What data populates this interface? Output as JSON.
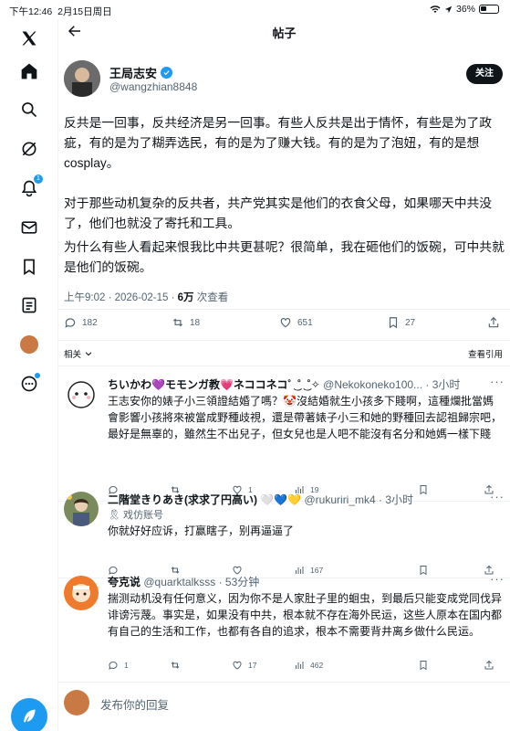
{
  "statusbar": {
    "time": "下午12:46",
    "date": "2月15日周日",
    "battery": "36%"
  },
  "topbar": {
    "title": "帖子"
  },
  "post": {
    "name": "王局志安",
    "handle": "@wangzhian8848",
    "follow_label": "关注",
    "paragraphs": [
      "反共是一回事，反共经济是另一回事。有些人反共是出于情怀，有些是为了政疵，有的是为了糊弄选民，有的是为了赚大钱。有的是为了泡妞，有的是想cosplay。",
      "对于那些动机复杂的反共者，共产党其实是他们的衣食父母，如果哪天中共没了，他们也就没了寄托和工具。",
      "为什么有些人看起来恨我比中共更甚呢？很简单，我在砸他们的饭碗，可中共就是他们的饭碗。"
    ],
    "time": "上午9:02 · 2026-02-15 · ",
    "views": "6万",
    "views_label": " 次查看",
    "stats": {
      "replies": "182",
      "reposts": "18",
      "likes": "651",
      "bookmarks": "27"
    }
  },
  "related": {
    "label": "相关",
    "quotes_label": "查看引用"
  },
  "replies": [
    {
      "name": "ちいかわ💜モモンガ教💗ネココネコ˚ ͜ ˚ ͜ ˚✧",
      "handle": "@Nekokoneko100... · 3小时",
      "text": "王志安你的婊子小三領證結婚了嗎？🤡沒結婚就生小孩多下賤啊，這種爛批當媽會影響小孩將來被當成野種歧視，還是帶著婊子小三和她的野種回去認祖歸宗吧，最好是無辜的，雖然生不出兒子，但女兒也是人吧不能沒有名分和她媽一樣下賤",
      "stats": {
        "replies": "",
        "reposts": "",
        "likes": "1",
        "views": "19"
      }
    },
    {
      "name": "二階堂きりあき(求求了円高い) 🤍💙💛",
      "handle": "@rukuriri_mk4 · 3小时",
      "tag": "🎗 戏仿账号",
      "text": "你就好好应诉，打赢瞎子，别再逼逼了",
      "stats": {
        "replies": "",
        "reposts": "",
        "likes": "",
        "views": "167"
      }
    },
    {
      "name": "夸克说",
      "handle": "@quarktalksss · 53分钟",
      "text": "揣测动机没有任何意义，因为你不是人家肚子里的蛔虫，到最后只能变成党同伐异诽谤污蔑。事实是，如果没有中共，根本就不存在海外民运，这些人原本在国内都有自己的生活和工作，也都有各自的追求，根本不需要背井离乡做什么民运。",
      "stats": {
        "replies": "1",
        "reposts": "",
        "likes": "17",
        "views": "462"
      }
    }
  ],
  "reply_box": {
    "placeholder": "发布你的回复"
  },
  "colors": {
    "accent": "#1d9bf0",
    "text": "#0f1419",
    "muted": "#536471"
  }
}
